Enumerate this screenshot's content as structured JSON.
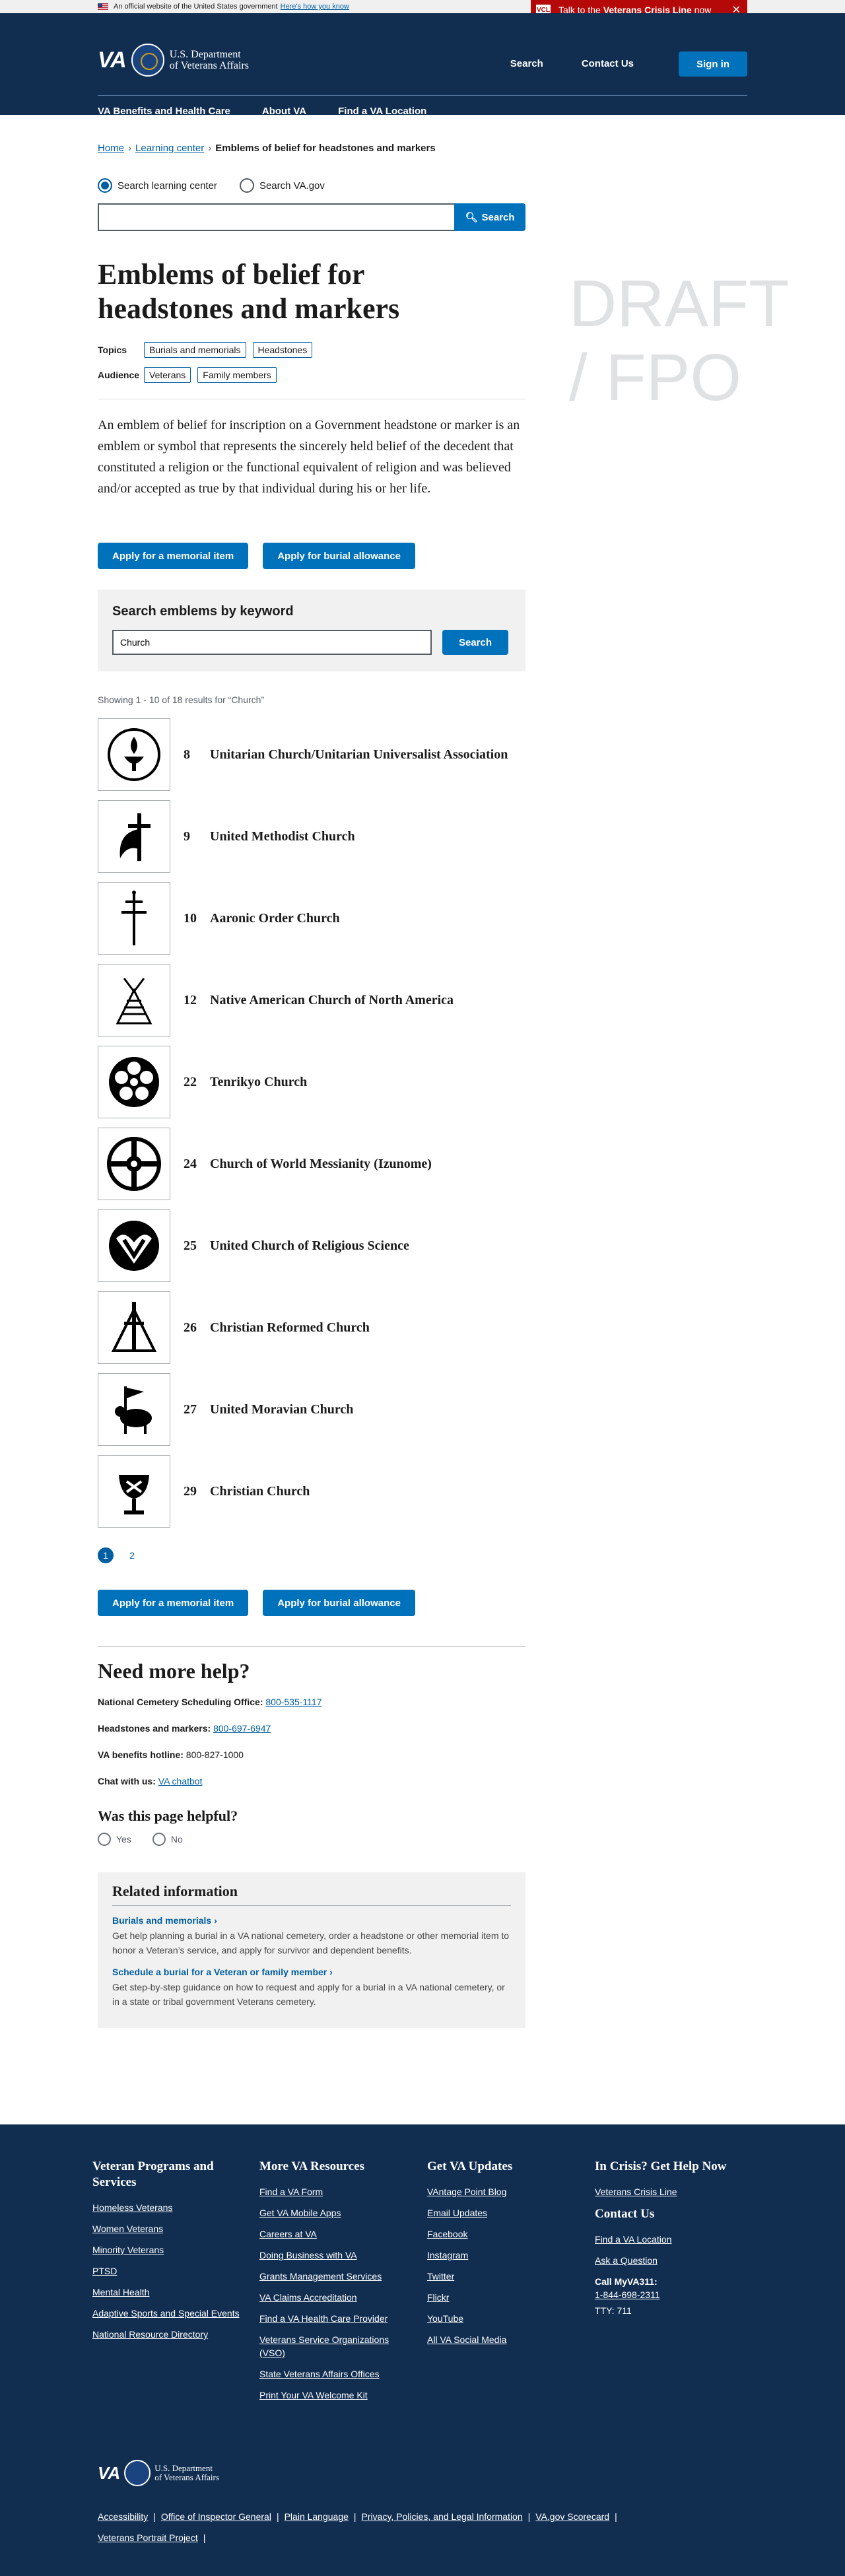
{
  "gov_banner": {
    "text": "An official website of the United States government",
    "link": "Here's how you know"
  },
  "crisis_line": {
    "prefix": "Talk to the",
    "bold": "Veterans Crisis Line",
    "suffix": "now",
    "icon_label": "VCL"
  },
  "header": {
    "logo_text": "VA",
    "dept_line1": "U.S. Department",
    "dept_line2": "of Veterans Affairs",
    "search": "Search",
    "contact": "Contact Us",
    "sign_in": "Sign in",
    "menu": [
      "VA Benefits and Health Care",
      "About VA",
      "Find a VA Location"
    ]
  },
  "breadcrumb": {
    "home": "Home",
    "learning": "Learning center",
    "current": "Emblems of belief for headstones and markers"
  },
  "search": {
    "option1": "Search learning center",
    "option2": "Search VA.gov",
    "button": "Search",
    "value": ""
  },
  "page": {
    "title": "Emblems of belief for headstones and markers",
    "draft": "DRAFT / FPO",
    "topics_label": "Topics",
    "topics": [
      "Burials and memorials",
      "Headstones"
    ],
    "audience_label": "Audience",
    "audience": [
      "Veterans",
      "Family members"
    ],
    "intro": "An emblem of belief for inscription on a Government headstone or marker is an emblem or symbol that represents the sincerely held belief of the decedent that constituted a religion or the functional equivalent of religion and was believed and/or accepted as true by that individual during his or her life.",
    "btn_memorial": "Apply for a memorial item",
    "btn_burial": "Apply for burial allowance"
  },
  "keyword": {
    "heading": "Search emblems by keyword",
    "value": "Church",
    "button": "Search"
  },
  "results_text": "Showing 1 - 10 of 18 results for “Church”",
  "emblems": [
    {
      "num": "8",
      "name": "Unitarian Church/Unitarian Universalist Association",
      "icon": "chalice-circle-icon"
    },
    {
      "num": "9",
      "name": "United Methodist Church",
      "icon": "cross-flame-icon"
    },
    {
      "num": "10",
      "name": "Aaronic Order Church",
      "icon": "double-cross-icon"
    },
    {
      "num": "12",
      "name": "Native American Church of North America",
      "icon": "tipi-bird-icon"
    },
    {
      "num": "22",
      "name": "Tenrikyo Church",
      "icon": "flower-crest-icon"
    },
    {
      "num": "24",
      "name": "Church of World Messianity (Izunome)",
      "icon": "wheel-cross-icon"
    },
    {
      "num": "25",
      "name": "United Church of Religious Science",
      "icon": "heart-v-icon"
    },
    {
      "num": "26",
      "name": "Christian Reformed Church",
      "icon": "triangle-cross-icon"
    },
    {
      "num": "27",
      "name": "United Moravian Church",
      "icon": "lamb-banner-icon"
    },
    {
      "num": "29",
      "name": "Christian Church",
      "icon": "chalice-icon"
    }
  ],
  "pagination": {
    "pages": [
      "1",
      "2"
    ],
    "current": "1"
  },
  "help": {
    "heading": "Need more help?",
    "lines": [
      {
        "label": "National Cemetery Scheduling Office:",
        "value": "800-535-1117",
        "link": true
      },
      {
        "label": "Headstones and markers:",
        "value": "800-697-6947",
        "link": true
      },
      {
        "label": "VA benefits hotline:",
        "value": "800-827-1000",
        "link": false
      },
      {
        "label": "Chat with us:",
        "value": "VA chatbot",
        "link": true
      }
    ]
  },
  "helpful": {
    "heading": "Was this page helpful?",
    "yes": "Yes",
    "no": "No"
  },
  "related": {
    "heading": "Related information",
    "items": [
      {
        "link": "Burials and memorials",
        "desc": "Get help planning a burial in a VA national cemetery, order a headstone or other memorial item to honor a Veteran’s service, and apply for survivor and dependent benefits."
      },
      {
        "link": "Schedule a burial for a Veteran or family member",
        "desc": "Get step-by-step guidance on how to request and apply for a burial in a VA national cemetery, or in a state or tribal government Veterans cemetery."
      }
    ]
  },
  "footer": {
    "col1": {
      "title": "Veteran Programs and Services",
      "links": [
        "Homeless Veterans",
        "Women Veterans",
        "Minority Veterans",
        "PTSD",
        "Mental Health",
        "Adaptive Sports and Special Events",
        "National Resource Directory"
      ]
    },
    "col2": {
      "title": "More VA Resources",
      "links": [
        "Find a VA Form",
        "Get VA Mobile Apps",
        "Careers at VA",
        "Doing Business with VA",
        "Grants Management Services",
        "VA Claims Accreditation",
        "Find a VA Health Care Provider",
        "Veterans Service Organizations (VSO)",
        "State Veterans Affairs Offices",
        "Print Your VA Welcome Kit"
      ]
    },
    "col3": {
      "title": "Get VA Updates",
      "links": [
        "VAntage Point Blog",
        "Email Updates",
        "Facebook",
        "Instagram",
        "Twitter",
        "Flickr",
        "YouTube",
        "All VA Social Media"
      ]
    },
    "col4": {
      "title": "In Crisis? Get Help Now",
      "crisis_link": "Veterans Crisis Line",
      "contact_title": "Contact Us",
      "contact_links": [
        "Find a VA Location",
        "Ask a Question"
      ],
      "call_label": "Call MyVA311:",
      "call_number": "1-844-698-2311",
      "tty": "TTY: 711"
    },
    "bottom_links": [
      "Accessibility",
      "Office of Inspector General",
      "Plain Language",
      "Privacy, Policies, and Legal Information",
      "VA.gov Scorecard",
      "Veterans Portrait Project"
    ]
  }
}
